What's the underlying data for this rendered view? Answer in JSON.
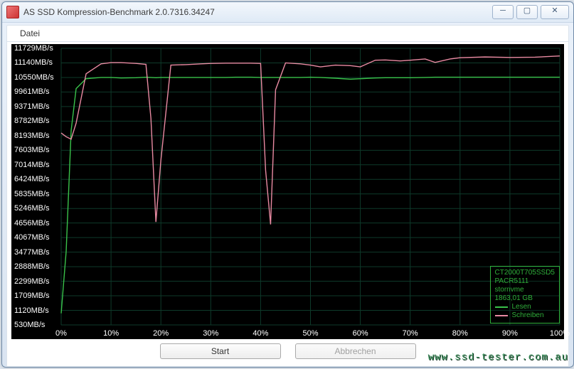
{
  "window": {
    "title": "AS SSD Kompression-Benchmark 2.0.7316.34247"
  },
  "menubar": {
    "items": [
      "Datei"
    ]
  },
  "buttons": {
    "start": "Start",
    "cancel": "Abbrechen"
  },
  "legend": {
    "device": "CT2000T705SSD5",
    "firmware": "PACR5111",
    "driver": "stornvme",
    "capacity": "1863,01 GB",
    "read_label": "Lesen",
    "write_label": "Schreiben"
  },
  "watermark": "www.ssd-tester.com.au",
  "chart_data": {
    "type": "line",
    "xlabel": "",
    "ylabel": "",
    "xunit": "%",
    "yunit": "MB/s",
    "xlim": [
      0,
      100
    ],
    "ylim": [
      530,
      11729
    ],
    "yticks": [
      530,
      1120,
      1709,
      2299,
      2888,
      3477,
      4067,
      4656,
      5246,
      5835,
      6424,
      7014,
      7603,
      8193,
      8782,
      9371,
      9961,
      10550,
      11140,
      11729
    ],
    "xticks": [
      0,
      10,
      20,
      30,
      40,
      50,
      60,
      70,
      80,
      90,
      100
    ],
    "x": [
      0,
      1,
      2,
      3,
      5,
      8,
      10,
      12,
      15,
      17,
      18,
      19,
      20,
      22,
      25,
      28,
      30,
      33,
      35,
      38,
      40,
      41,
      42,
      43,
      45,
      48,
      50,
      52,
      55,
      58,
      60,
      63,
      65,
      68,
      70,
      73,
      75,
      78,
      80,
      85,
      90,
      95,
      100
    ],
    "series": [
      {
        "name": "Lesen",
        "color": "#39c24a",
        "values": [
          1000,
          3500,
          8400,
          10100,
          10500,
          10550,
          10550,
          10530,
          10540,
          10560,
          10550,
          10540,
          10550,
          10550,
          10550,
          10550,
          10550,
          10550,
          10560,
          10560,
          10550,
          10550,
          10550,
          10550,
          10550,
          10550,
          10560,
          10550,
          10520,
          10480,
          10500,
          10530,
          10540,
          10540,
          10540,
          10550,
          10560,
          10560,
          10560,
          10560,
          10560,
          10560,
          10560
        ]
      },
      {
        "name": "Schreiben",
        "color": "#e98aa2",
        "values": [
          8300,
          8150,
          8050,
          8700,
          10700,
          11100,
          11150,
          11150,
          11120,
          11080,
          8900,
          4700,
          7200,
          11050,
          11070,
          11100,
          11120,
          11130,
          11130,
          11130,
          11120,
          6800,
          4600,
          10050,
          11140,
          11100,
          11050,
          10980,
          11050,
          11030,
          10980,
          11250,
          11260,
          11220,
          11250,
          11300,
          11160,
          11300,
          11350,
          11380,
          11360,
          11370,
          11420
        ]
      }
    ]
  }
}
